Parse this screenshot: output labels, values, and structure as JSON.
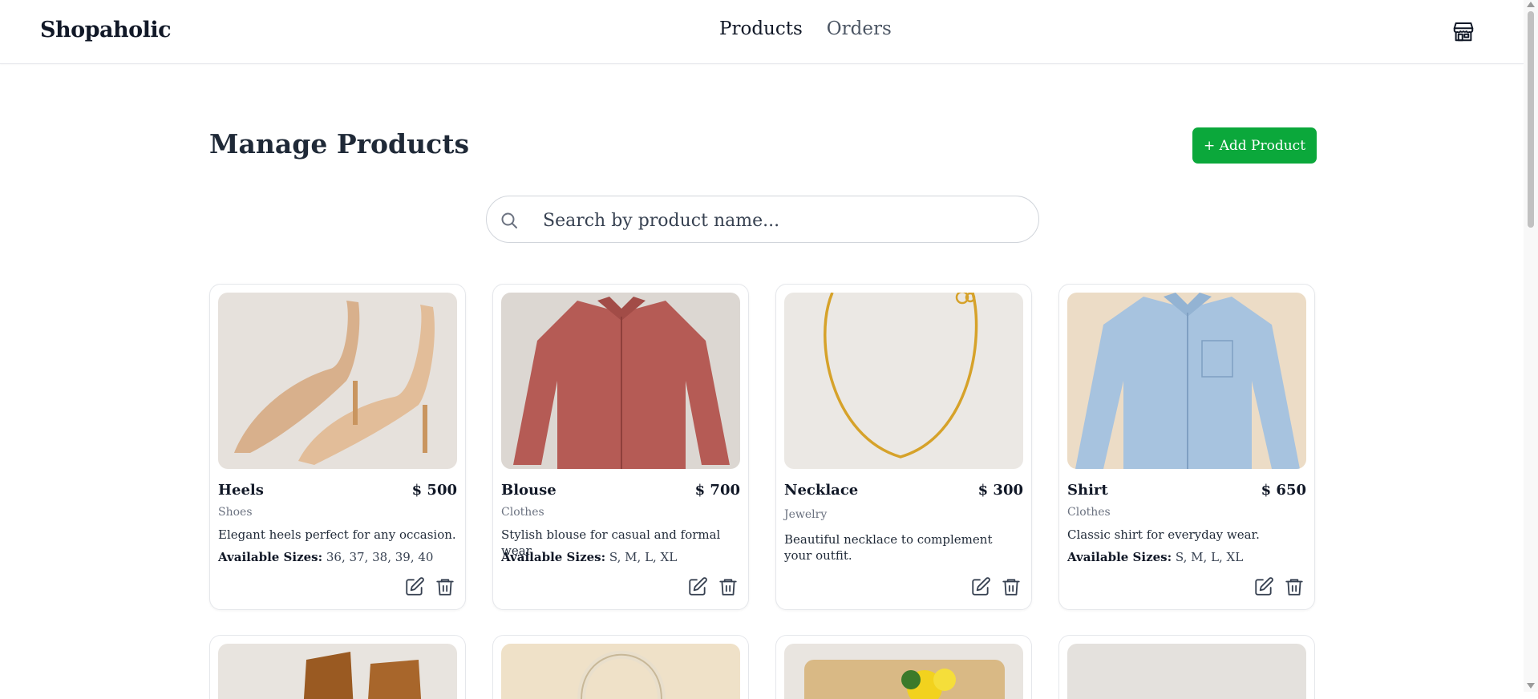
{
  "brand": "Shopaholic",
  "nav": {
    "products": "Products",
    "orders": "Orders"
  },
  "page_title": "Manage Products",
  "add_button": "+ Add Product",
  "search": {
    "placeholder": "Search by product name..."
  },
  "sizes_label": "Available Sizes:",
  "products": [
    {
      "name": "Heels",
      "price": "$ 500",
      "category": "Shoes",
      "description": "Elegant heels perfect for any occasion.",
      "sizes": "36, 37, 38, 39, 40"
    },
    {
      "name": "Blouse",
      "price": "$ 700",
      "category": "Clothes",
      "description": "Stylish blouse for casual and formal wear.",
      "sizes": "S, M, L, XL"
    },
    {
      "name": "Necklace",
      "price": "$ 300",
      "category": "Jewelry",
      "description": "Beautiful necklace to complement your outfit.",
      "sizes": ""
    },
    {
      "name": "Shirt",
      "price": "$ 650",
      "category": "Clothes",
      "description": "Classic shirt for everyday wear.",
      "sizes": "S, M, L, XL"
    }
  ],
  "colors": {
    "accent": "#0ba83b"
  }
}
